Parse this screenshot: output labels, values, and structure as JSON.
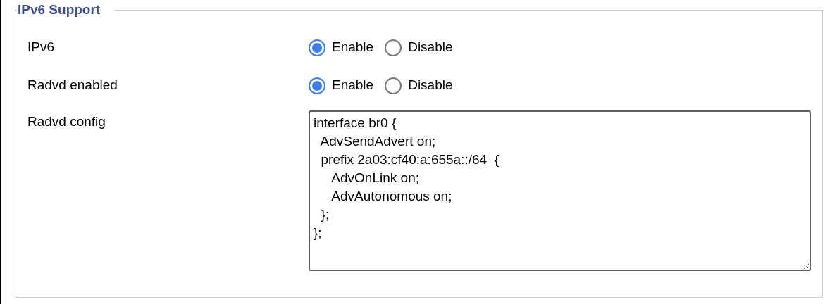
{
  "section": {
    "title": "IPv6 Support"
  },
  "rows": [
    {
      "kind": "radio",
      "label": "IPv6",
      "options": [
        {
          "label": "Enable",
          "selected": true
        },
        {
          "label": "Disable",
          "selected": false
        }
      ]
    },
    {
      "kind": "radio",
      "label": "Radvd enabled",
      "options": [
        {
          "label": "Enable",
          "selected": true
        },
        {
          "label": "Disable",
          "selected": false
        }
      ]
    },
    {
      "kind": "textarea",
      "label": "Radvd config",
      "value": "interface br0 {\n  AdvSendAdvert on;\n  prefix 2a03:cf40:a:655a::/64  {\n     AdvOnLink on;\n     AdvAutonomous on;\n  };\n};"
    }
  ]
}
